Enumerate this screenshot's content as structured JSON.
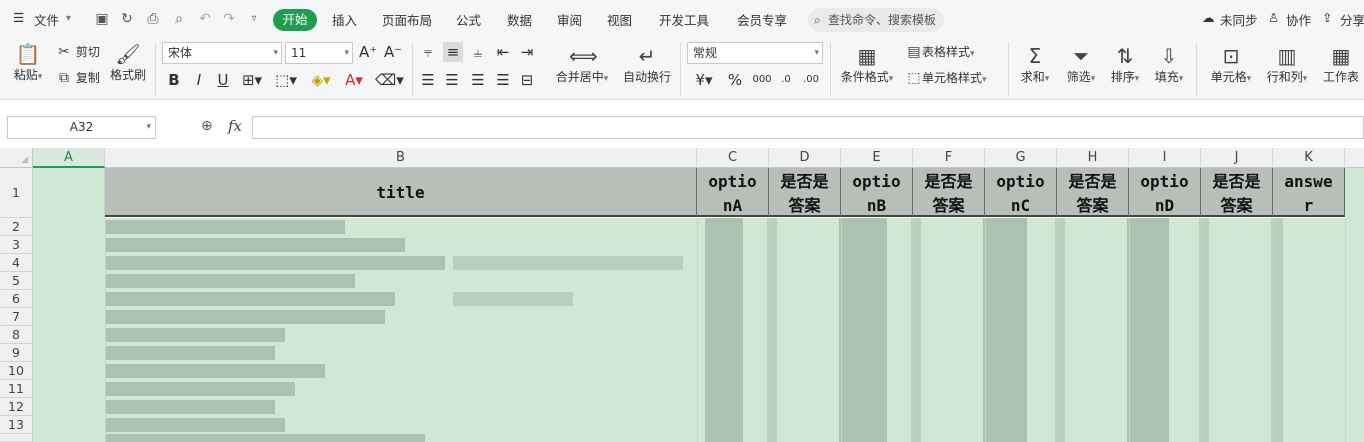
{
  "menubar": {
    "file": "文件",
    "tabs": [
      "开始",
      "插入",
      "页面布局",
      "公式",
      "数据",
      "审阅",
      "视图",
      "开发工具",
      "会员专享"
    ],
    "search_placeholder": "查找命令、搜索模板",
    "right": {
      "sync": "未同步",
      "collab": "协作",
      "share": "分享"
    }
  },
  "ribbon": {
    "paste": "粘贴",
    "cut": "剪切",
    "copy": "复制",
    "format_painter": "格式刷",
    "font_name": "宋体",
    "font_size": "11",
    "merge_center": "合并居中",
    "wrap_text": "自动换行",
    "number_format": "常规",
    "cond_format": "条件格式",
    "table_style": "表格样式",
    "cell_style": "单元格样式",
    "sum": "求和",
    "filter": "筛选",
    "sort": "排序",
    "fill": "填充",
    "cell": "单元格",
    "row_col": "行和列",
    "worksheet": "工作表"
  },
  "formula_bar": {
    "cell_ref": "A32",
    "fx": "fx",
    "value": ""
  },
  "columns": [
    "A",
    "B",
    "C",
    "D",
    "E",
    "F",
    "G",
    "H",
    "I",
    "J",
    "K"
  ],
  "selected_column": "A",
  "rows": [
    "1",
    "2",
    "3",
    "4",
    "5",
    "6",
    "7",
    "8",
    "9",
    "10",
    "11",
    "12",
    "13"
  ],
  "header_row": [
    "",
    "title",
    "optio nA",
    "是否是 答案",
    "optio nB",
    "是否是 答案",
    "optio nC",
    "是否是 答案",
    "optio nD",
    "是否是 答案",
    "answe r"
  ]
}
